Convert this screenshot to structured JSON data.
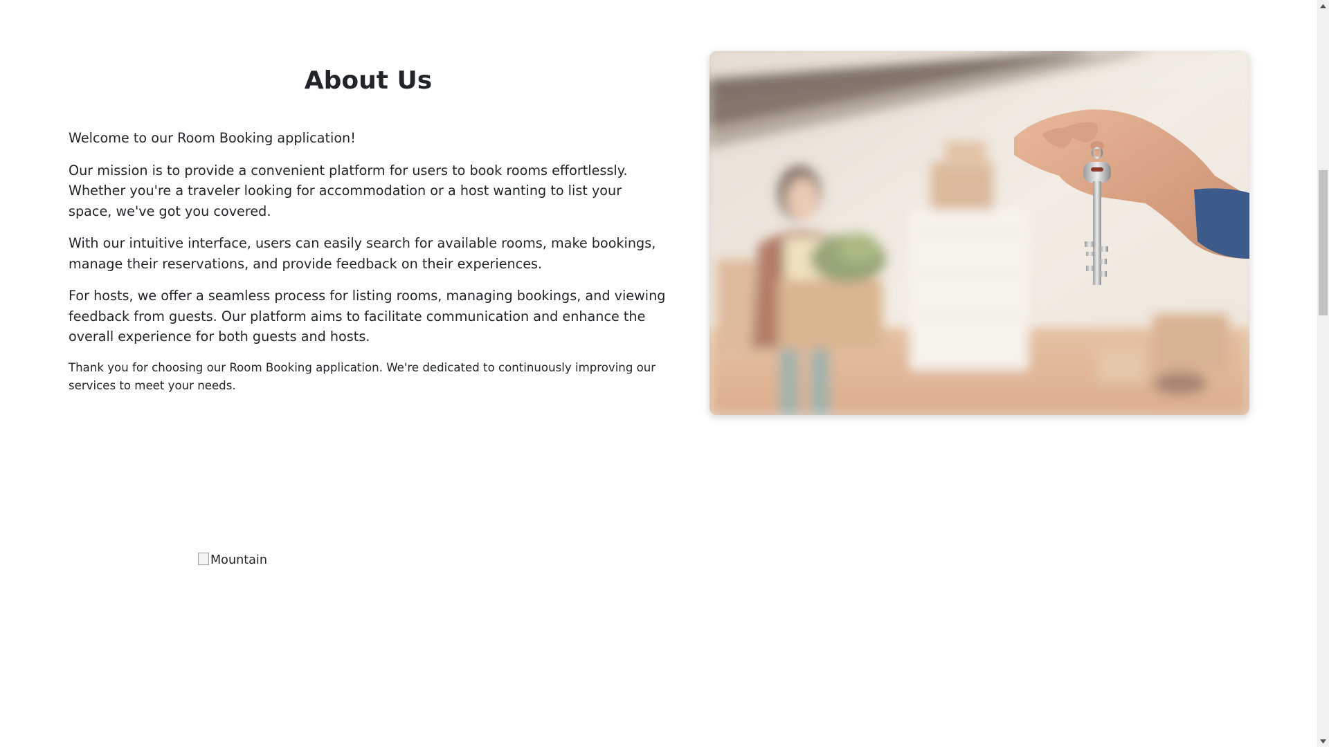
{
  "about": {
    "title": "About Us",
    "paragraphs": [
      "Welcome to our Room Booking application!",
      "Our mission is to provide a convenient platform for users to book rooms effortlessly. Whether you're a traveler looking for accommodation or a host wanting to list your space, we've got you covered.",
      "With our intuitive interface, users can easily search for available rooms, make bookings, manage their reservations, and provide feedback on their experiences.",
      "For hosts, we offer a seamless process for listing rooms, managing bookings, and viewing feedback from guests. Our platform aims to facilitate communication and enhance the overall experience for both guests and hosts."
    ],
    "closing": "Thank you for choosing our Room Booking application. We're dedicated to continuously improving our services to meet your needs."
  },
  "images": {
    "hero_subject": "hand-holding-keys-photo",
    "broken_alt": "Mountain"
  },
  "colors": {
    "text": "#212529",
    "background": "#ffffff",
    "scrollbar_track": "#f1f1f1",
    "scrollbar_thumb": "#c1c1c1"
  }
}
